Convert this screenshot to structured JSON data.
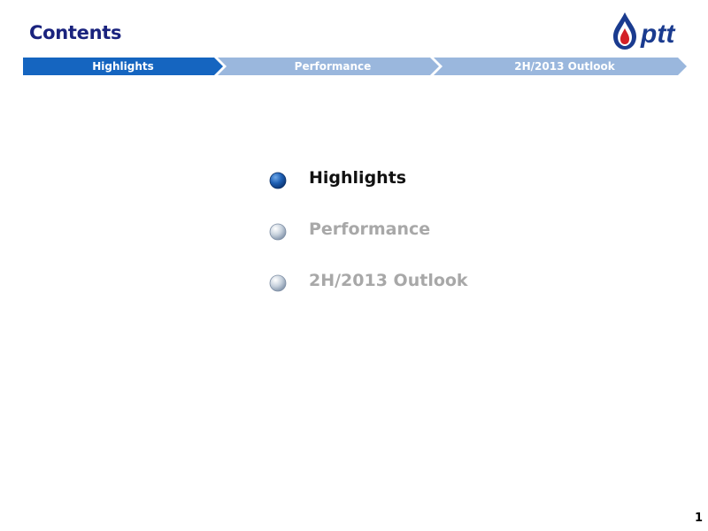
{
  "slide": {
    "title": "Contents",
    "page_number": "1"
  },
  "logo": {
    "brand_text": "ptt",
    "icon": "ptt-flame-logo-icon"
  },
  "nav_bar": {
    "segments": [
      {
        "label": "Highlights",
        "active": true
      },
      {
        "label": "Performance",
        "active": false
      },
      {
        "label": "2H/2013 Outlook",
        "active": false
      }
    ]
  },
  "menu": {
    "items": [
      {
        "label": "Highlights",
        "active": true
      },
      {
        "label": "Performance",
        "active": false
      },
      {
        "label": "2H/2013 Outlook",
        "active": false
      }
    ]
  },
  "colors": {
    "title": "#1a237e",
    "nav_active": "#1565c0",
    "nav_inactive": "#9ab7dd",
    "menu_active_text": "#111111",
    "menu_inactive_text": "#a8a8a8",
    "bullet_active": "#1e5fb3",
    "bullet_inactive": "#c9d3de"
  }
}
